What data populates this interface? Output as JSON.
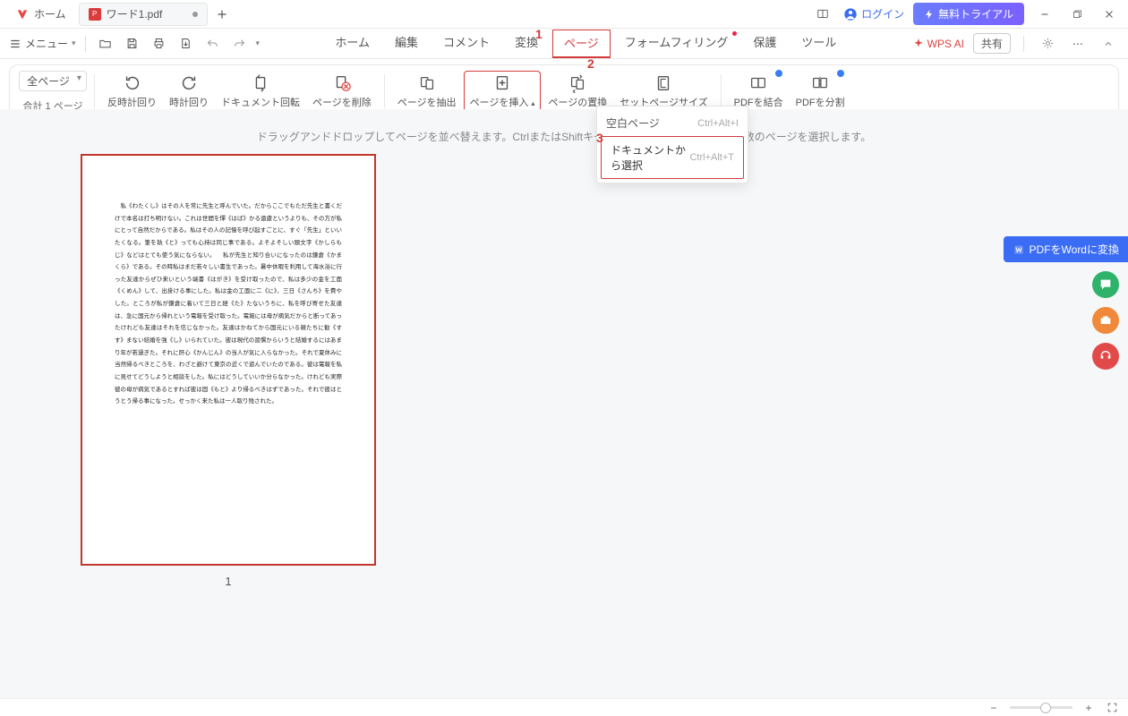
{
  "titlebar": {
    "home_label": "ホーム",
    "file_label": "ワード1.pdf",
    "login_label": "ログイン",
    "trial_label": "無料トライアル"
  },
  "row2": {
    "menu_label": "メニュー",
    "tabs": {
      "home": "ホーム",
      "edit": "編集",
      "comment": "コメント",
      "convert": "変換",
      "page": "ページ",
      "form": "フォームフィリング",
      "protect": "保護",
      "tool": "ツール"
    },
    "wps_ai": "WPS AI",
    "share": "共有"
  },
  "ribbon": {
    "page_dropdown": "全ページ",
    "total": "合計 1 ページ",
    "ccw": "反時計回り",
    "cw": "時計回り",
    "docrot": "ドキュメント回転",
    "delete": "ページを削除",
    "extract": "ページを抽出",
    "insert": "ページを挿入",
    "replace": "ページの置換",
    "setsize": "セットページサイズ",
    "merge": "PDFを結合",
    "split": "PDFを分割"
  },
  "dropdown": {
    "blank_label": "空白ページ",
    "blank_sc": "Ctrl+Alt+I",
    "fromdoc_label": "ドキュメントから選択",
    "fromdoc_sc": "Ctrl+Alt+T"
  },
  "canvas": {
    "hint": "ドラッグアンドドロップしてページを並べ替えます。CtrlまたはShiftキーを押しながらクリックして複数のページを選択します。",
    "page_number": "1",
    "body": "　私《わたくし》はその人を常に先生と呼んでいた。だからここでもただ先生と書くだけで本名は打ち明けない。これは世間を憚《はば》かる遠慮というよりも、その方が私にとって自然だからである。私はその人の記憶を呼び起すごとに、すぐ「先生」といいたくなる。筆を執《と》っても心持は同じ事である。よそよそしい頭文字《かしらもじ》などはとても使う気にならない。\n　私が先生と知り合いになったのは鎌倉《かまくら》である。その時私はまだ若々しい書生であった。暑中休暇を利用して海水浴に行った友達からぜひ来いという端書《はがき》を受け取ったので、私は多少の金を工面《くめん》して、出掛ける事にした。私は金の工面に二《に》、三日《さんち》を費やした。ところが私が鎌倉に着いて三日と経《た》たないうちに、私を呼び寄せた友達は、急に国元から帰れという電報を受け取った。電報には母が病気だからと断ってあったけれども友達はそれを信じなかった。友達はかねてから国元にいる親たちに勧《すす》まない結婚を強《し》いられていた。彼は現代の習慣からいうと結婚するにはあまり年が若過ぎた。それに肝心《かんじん》の当人が気に入らなかった。それで夏休みに当然帰るべきところを、わざと避けて東京の近くで遊んでいたのである。彼は電報を私に見せてどうしようと相談をした。私にはどうしていいか分らなかった。けれども実際彼の母が病気であるとすれば彼は固《もと》より帰るべきはずであった。それで彼はとうとう帰る事になった。せっかく来た私は一人取り残された。"
  },
  "float": {
    "convert_label": "PDFをWordに変換"
  },
  "callouts": {
    "c1": "1",
    "c2": "2",
    "c3": "3"
  }
}
